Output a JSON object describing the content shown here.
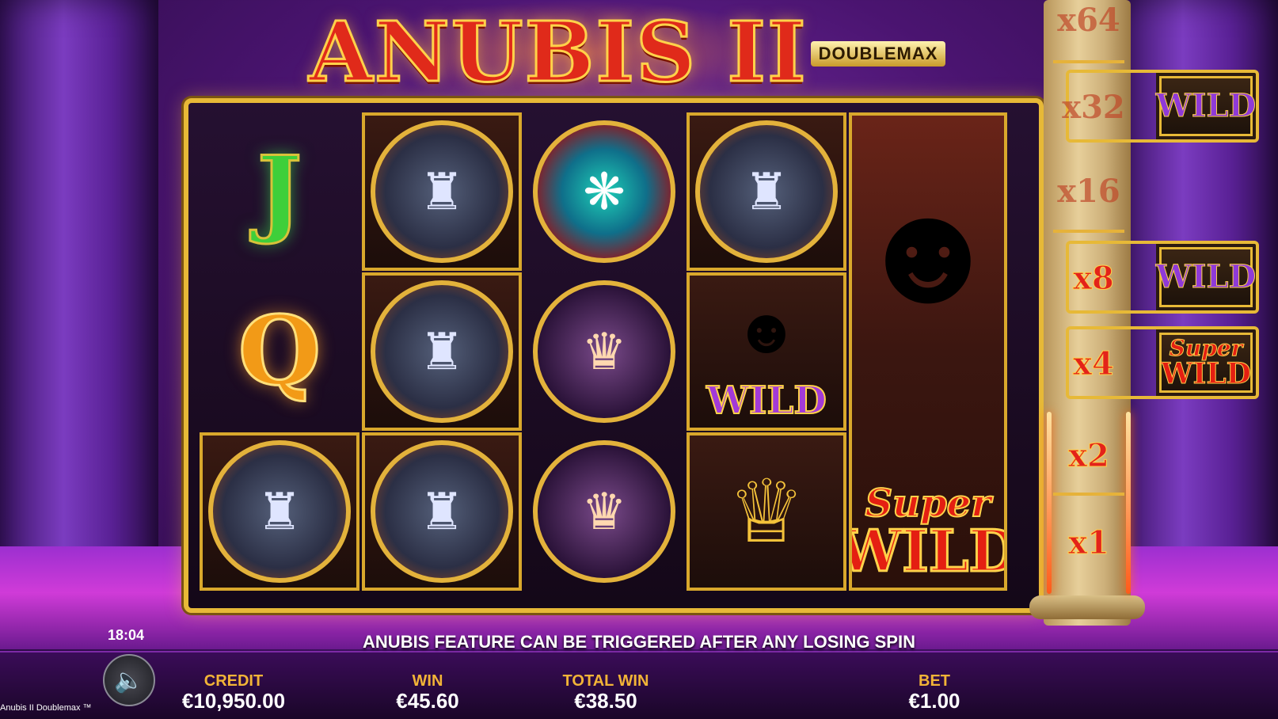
{
  "logo": {
    "title": "ANUBIS II",
    "subtitle": "DOUBLEMAX"
  },
  "reels": {
    "col1": {
      "top": "J",
      "mid": "Q",
      "bottom_icon": "anubis-symbol"
    },
    "col2": [
      "anubis-symbol",
      "anubis-symbol",
      "anubis-symbol"
    ],
    "col3": [
      "scarab-symbol",
      "cleopatra-symbol",
      "cleopatra-symbol"
    ],
    "col4": {
      "top_icon": "anubis-symbol",
      "mid_label": "WILD",
      "bottom_icon": "pharaoh-mask-symbol"
    },
    "col5": {
      "super": "Super",
      "wild": "WILD"
    }
  },
  "multiplier_ladder": {
    "x64": "x64",
    "x32": "x32",
    "x32_label": "WILD",
    "x16": "x16",
    "x8": "x8",
    "x8_label": "WILD",
    "x4": "x4",
    "x4_super": "Super",
    "x4_wild": "WILD",
    "x2": "x2",
    "x1": "x1"
  },
  "banner": "ANUBIS FEATURE CAN BE TRIGGERED AFTER ANY LOSING SPIN",
  "clock": "18:04",
  "stats": {
    "credit_label": "CREDIT",
    "credit_value": "€10,950.00",
    "win_label": "WIN",
    "win_value": "€45.60",
    "total_win_label": "TOTAL WIN",
    "total_win_value": "€38.50",
    "bet_label": "BET",
    "bet_value": "€1.00"
  },
  "game_name": "Anubis II Doublemax ™",
  "icons": {
    "sound": "speaker-icon"
  },
  "colors": {
    "gold": "#e7b937",
    "wild_red": "#e41f12",
    "wild_purple": "#a23ad8",
    "label_gold": "#f2b437"
  }
}
